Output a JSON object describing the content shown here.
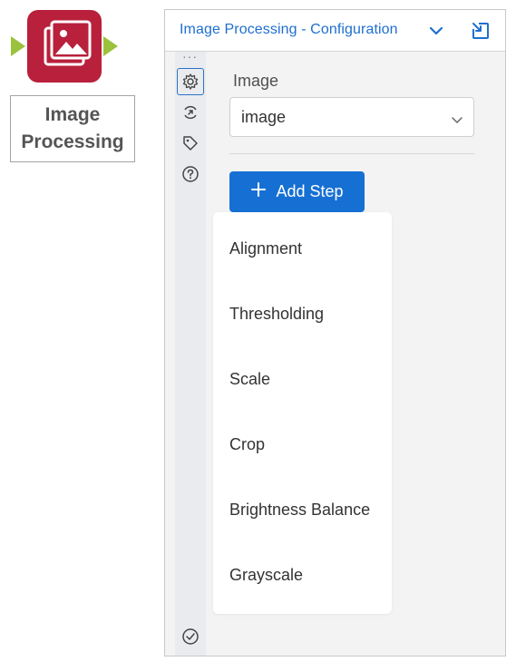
{
  "tool": {
    "label_line1": "Image",
    "label_line2": "Processing",
    "icon": "image-processing-icon",
    "icon_color": "#b8203b",
    "anchor_color": "#9bc23c"
  },
  "panel": {
    "title": "Image Processing - Configuration",
    "accent_color": "#1e6fcf",
    "sidebar_icons": [
      "gear-icon",
      "annotation-icon",
      "tag-icon",
      "help-icon",
      "check-circle-icon"
    ]
  },
  "config": {
    "image_label": "Image",
    "image_value": "image",
    "add_step_label": "Add Step",
    "add_step_color": "#1670d3",
    "menu_items": [
      "Alignment",
      "Thresholding",
      "Scale",
      "Crop",
      "Brightness Balance",
      "Grayscale"
    ]
  }
}
